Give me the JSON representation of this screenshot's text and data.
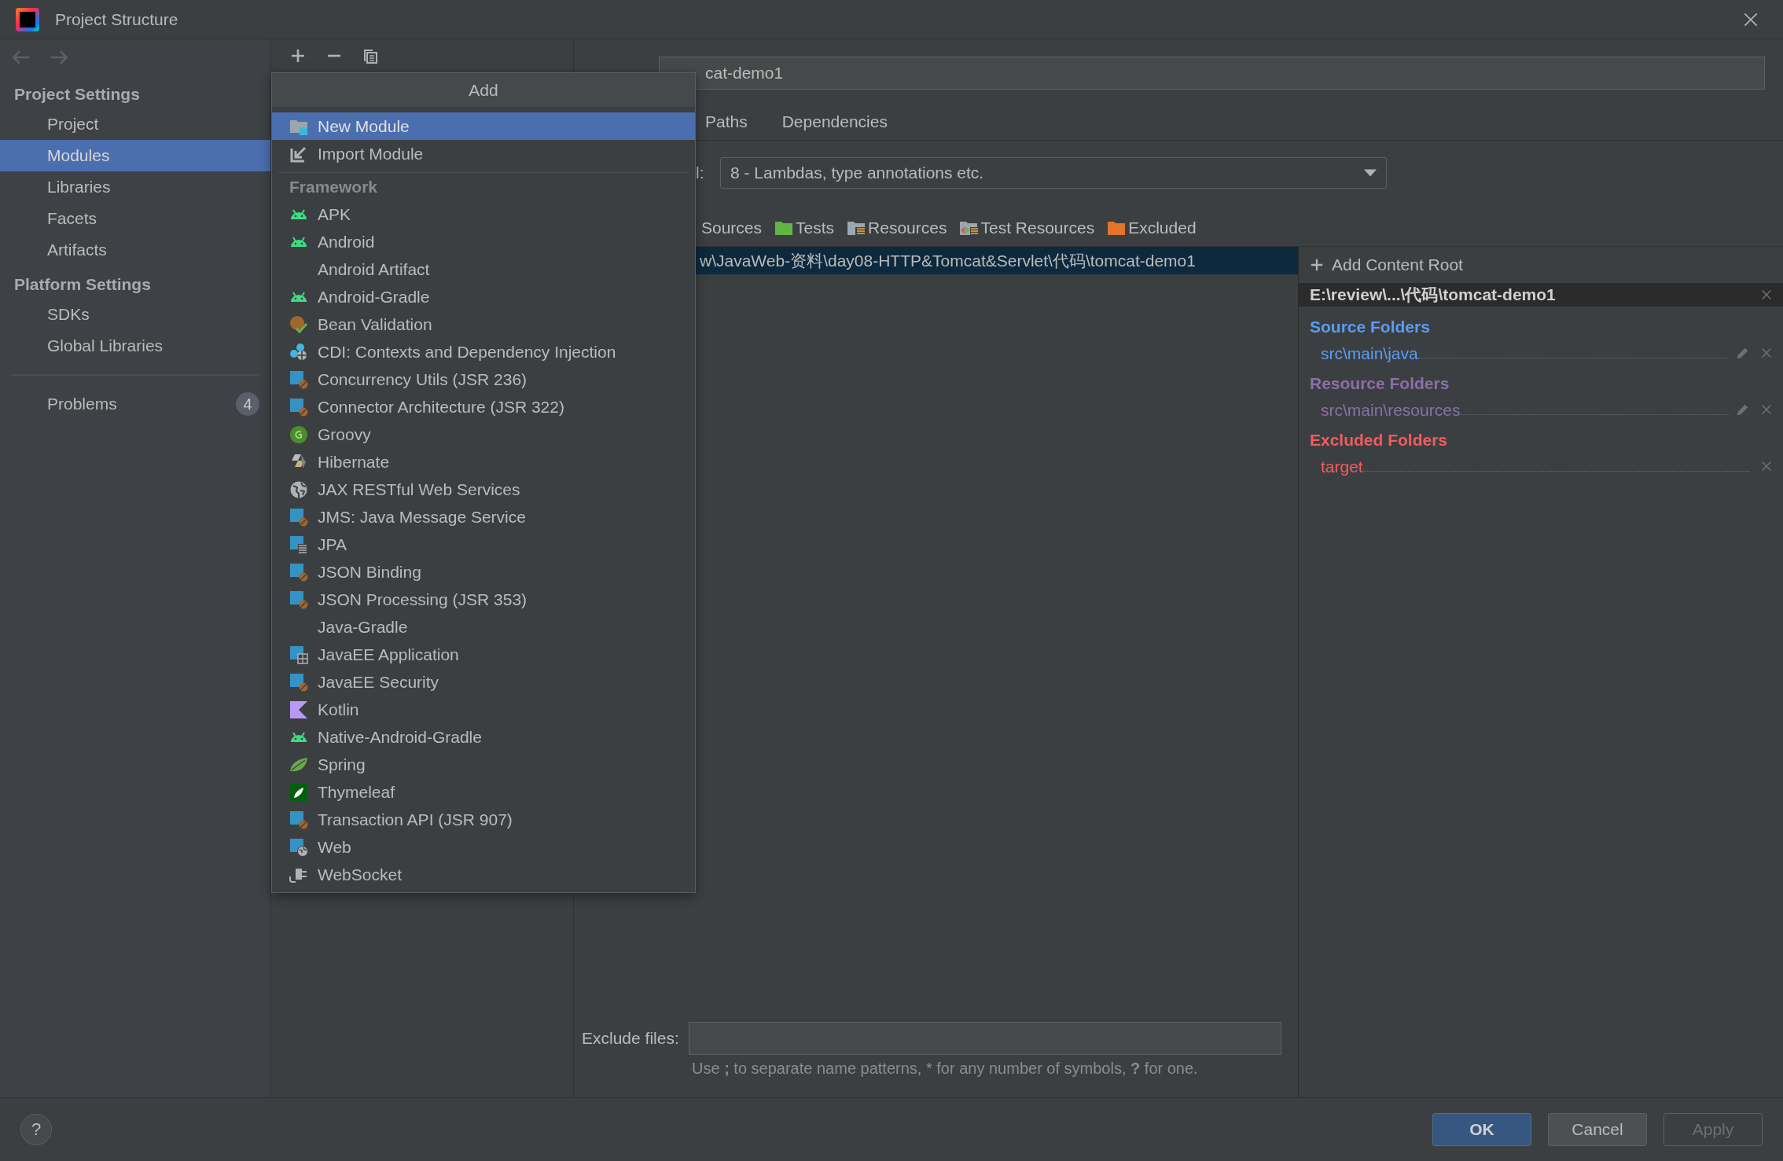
{
  "window": {
    "title": "Project Structure"
  },
  "sidebar": {
    "sections": [
      {
        "heading": "Project Settings",
        "items": [
          {
            "label": "Project",
            "selected": false
          },
          {
            "label": "Modules",
            "selected": true
          },
          {
            "label": "Libraries",
            "selected": false
          },
          {
            "label": "Facets",
            "selected": false
          },
          {
            "label": "Artifacts",
            "selected": false
          }
        ]
      },
      {
        "heading": "Platform Settings",
        "items": [
          {
            "label": "SDKs",
            "selected": false
          },
          {
            "label": "Global Libraries",
            "selected": false
          }
        ]
      }
    ],
    "problems": {
      "label": "Problems",
      "count": "4"
    }
  },
  "add_menu": {
    "title": "Add",
    "items": [
      {
        "label": "New Module",
        "kind": "module",
        "selected": true
      },
      {
        "label": "Import Module",
        "kind": "import",
        "selected": false
      }
    ],
    "framework_heading": "Framework",
    "frameworks": [
      {
        "label": "APK",
        "kind": "android",
        "selected": false
      },
      {
        "label": "Android",
        "kind": "android",
        "selected": false
      },
      {
        "label": "Android Artifact",
        "kind": "plain",
        "selected": false
      },
      {
        "label": "Android-Gradle",
        "kind": "android",
        "selected": false
      },
      {
        "label": "Bean Validation",
        "kind": "bean",
        "selected": false
      },
      {
        "label": "CDI: Contexts and Dependency Injection",
        "kind": "cdi",
        "selected": false
      },
      {
        "label": "Concurrency Utils (JSR 236)",
        "kind": "jee",
        "selected": false
      },
      {
        "label": "Connector Architecture (JSR 322)",
        "kind": "jee",
        "selected": false
      },
      {
        "label": "Groovy",
        "kind": "groovy",
        "selected": false
      },
      {
        "label": "Hibernate",
        "kind": "hibernate",
        "selected": false
      },
      {
        "label": "JAX RESTful Web Services",
        "kind": "globe",
        "selected": false
      },
      {
        "label": "JMS: Java Message Service",
        "kind": "jee",
        "selected": false
      },
      {
        "label": "JPA",
        "kind": "jpa",
        "selected": false
      },
      {
        "label": "JSON Binding",
        "kind": "jee",
        "selected": false
      },
      {
        "label": "JSON Processing (JSR 353)",
        "kind": "jee",
        "selected": false
      },
      {
        "label": "Java-Gradle",
        "kind": "plain",
        "selected": false
      },
      {
        "label": "JavaEE Application",
        "kind": "jeeapp",
        "selected": false
      },
      {
        "label": "JavaEE Security",
        "kind": "jee",
        "selected": false
      },
      {
        "label": "Kotlin",
        "kind": "kotlin",
        "selected": false
      },
      {
        "label": "Native-Android-Gradle",
        "kind": "android",
        "selected": false
      },
      {
        "label": "Spring",
        "kind": "spring",
        "selected": false
      },
      {
        "label": "Thymeleaf",
        "kind": "thymeleaf",
        "selected": false
      },
      {
        "label": "Transaction API (JSR 907)",
        "kind": "jee",
        "selected": false
      },
      {
        "label": "Web",
        "kind": "web",
        "selected": false
      },
      {
        "label": "WebSocket",
        "kind": "websocket",
        "selected": false
      }
    ]
  },
  "module": {
    "name_value": "cat-demo1",
    "tabs": [
      {
        "label": "Paths",
        "selected": false
      },
      {
        "label": "Dependencies",
        "selected": false
      }
    ],
    "language_level": {
      "label": "l:",
      "value": "8 - Lambdas, type annotations etc."
    },
    "mark_as": [
      {
        "label": "Sources",
        "kind": "sources"
      },
      {
        "label": "Tests",
        "kind": "tests"
      },
      {
        "label": "Resources",
        "kind": "resources"
      },
      {
        "label": "Test Resources",
        "kind": "test-resources"
      },
      {
        "label": "Excluded",
        "kind": "excluded"
      }
    ],
    "content_root_path": "w\\JavaWeb-资料\\day08-HTTP&Tomcat&Servlet\\代码\\tomcat-demo1",
    "exclude_files": {
      "label": "Exclude files:",
      "hint": "Use **;** to separate name patterns, * for any number of symbols, **?** for one."
    }
  },
  "roots_panel": {
    "add_label": "Add Content Root",
    "root": "E:\\review\\...\\代码\\tomcat-demo1",
    "groups": [
      {
        "heading": "Source Folders",
        "color": "#589df6",
        "folders": [
          {
            "path": "src\\main\\java",
            "editable": true
          }
        ]
      },
      {
        "heading": "Resource Folders",
        "color": "#8c6fa8",
        "folders": [
          {
            "path": "src\\main\\resources",
            "editable": true
          }
        ]
      },
      {
        "heading": "Excluded Folders",
        "color": "#f25c5c",
        "folders": [
          {
            "path": "target",
            "editable": false
          }
        ]
      }
    ]
  },
  "help": "?",
  "buttons": [
    {
      "label": "OK",
      "default": true,
      "disabled": false
    },
    {
      "label": "Cancel",
      "default": false,
      "disabled": false
    },
    {
      "label": "Apply",
      "default": false,
      "disabled": true
    }
  ]
}
